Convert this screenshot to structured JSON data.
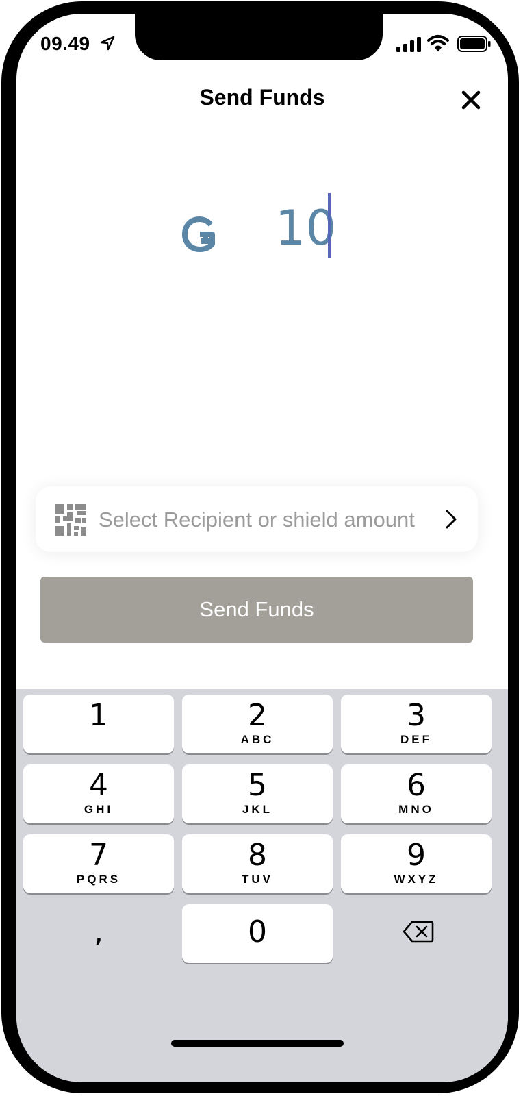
{
  "status_bar": {
    "time": "09.49"
  },
  "header": {
    "title": "Send Funds"
  },
  "amount": {
    "currency_icon": "gtu-currency-icon",
    "value": "10"
  },
  "recipient": {
    "placeholder": "Select Recipient or shield amount"
  },
  "send_button": {
    "label": "Send Funds"
  },
  "keyboard": {
    "keys": [
      {
        "digit": "1",
        "letters": ""
      },
      {
        "digit": "2",
        "letters": "ABC"
      },
      {
        "digit": "3",
        "letters": "DEF"
      },
      {
        "digit": "4",
        "letters": "GHI"
      },
      {
        "digit": "5",
        "letters": "JKL"
      },
      {
        "digit": "6",
        "letters": "MNO"
      },
      {
        "digit": "7",
        "letters": "PQRS"
      },
      {
        "digit": "8",
        "letters": "TUV"
      },
      {
        "digit": "9",
        "letters": "WXYZ"
      },
      {
        "digit": ",",
        "letters": ""
      },
      {
        "digit": "0",
        "letters": ""
      }
    ]
  },
  "colors": {
    "amount": "#5b86a6",
    "cursor": "#5566bb",
    "button_disabled": "#a3a09a",
    "keyboard_bg": "#d3d5db"
  }
}
